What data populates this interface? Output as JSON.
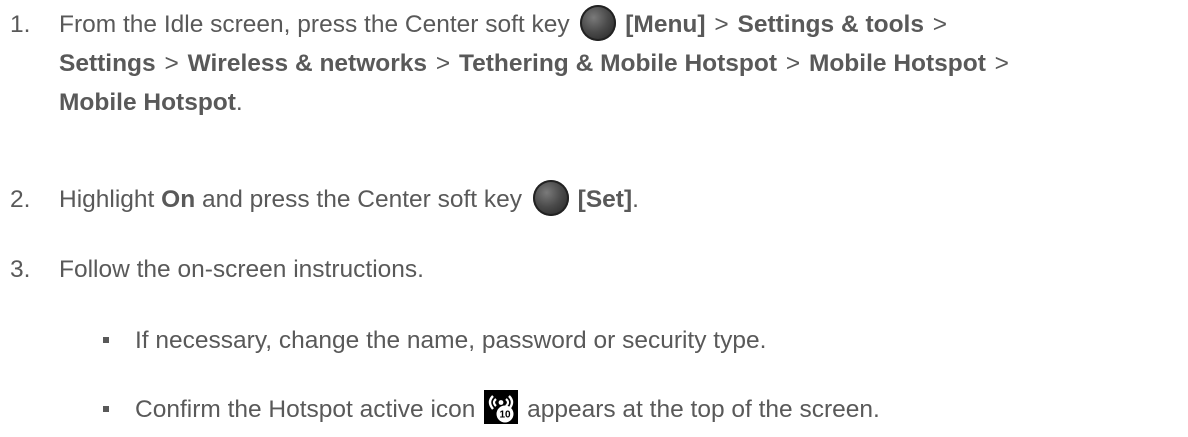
{
  "steps": [
    {
      "number": "1.",
      "prefix": "From the Idle screen, press the Center soft key",
      "menu": "[Menu]",
      "sep": ">",
      "path": [
        "Settings & tools",
        "Settings",
        "Wireless & networks",
        "Tethering & Mobile Hotspot",
        "Mobile Hotspot",
        "Mobile Hotspot"
      ],
      "end": "."
    },
    {
      "number": "2.",
      "prefix": "Highlight",
      "on": "On",
      "middle": "and press the Center soft key",
      "set": "[Set]",
      "end": "."
    },
    {
      "number": "3.",
      "text": "Follow the on-screen instructions."
    }
  ],
  "bullets": [
    {
      "text": "If necessary, change the name, password or security type."
    },
    {
      "before": "Confirm the Hotspot active icon",
      "after": "appears at the top of the screen."
    }
  ],
  "icons": {
    "soft_key": "center-soft-key-icon",
    "hotspot": "hotspot-active-icon"
  },
  "colors": {
    "text": "#595959",
    "icon_bg": "#000000"
  }
}
